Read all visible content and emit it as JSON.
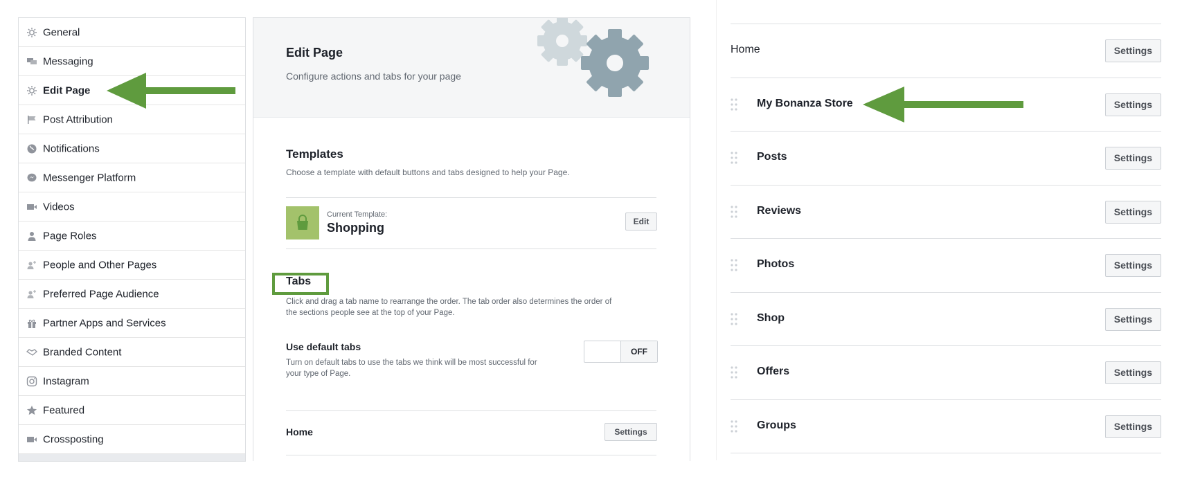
{
  "sidebar": {
    "items": [
      {
        "label": "General",
        "icon": "gear-icon",
        "active": false
      },
      {
        "label": "Messaging",
        "icon": "chat-bubbles-icon",
        "active": false
      },
      {
        "label": "Edit Page",
        "icon": "gear-icon",
        "active": true
      },
      {
        "label": "Post Attribution",
        "icon": "flag-icon",
        "active": false
      },
      {
        "label": "Notifications",
        "icon": "globe-icon",
        "active": false
      },
      {
        "label": "Messenger Platform",
        "icon": "messenger-icon",
        "active": false
      },
      {
        "label": "Videos",
        "icon": "video-camera-icon",
        "active": false
      },
      {
        "label": "Page Roles",
        "icon": "person-icon",
        "active": false
      },
      {
        "label": "People and Other Pages",
        "icon": "people-add-icon",
        "active": false
      },
      {
        "label": "Preferred Page Audience",
        "icon": "people-add-icon",
        "active": false
      },
      {
        "label": "Partner Apps and Services",
        "icon": "gift-box-icon",
        "active": false
      },
      {
        "label": "Branded Content",
        "icon": "handshake-icon",
        "active": false
      },
      {
        "label": "Instagram",
        "icon": "instagram-icon",
        "active": false
      },
      {
        "label": "Featured",
        "icon": "star-icon",
        "active": false
      },
      {
        "label": "Crossposting",
        "icon": "video-camera-icon",
        "active": false
      }
    ]
  },
  "main": {
    "title": "Edit Page",
    "subtitle": "Configure actions and tabs for your page",
    "templates": {
      "title": "Templates",
      "description": "Choose a template with default buttons and tabs designed to help your Page.",
      "current_label": "Current Template:",
      "current_name": "Shopping",
      "edit_label": "Edit"
    },
    "tabs": {
      "title": "Tabs",
      "description_line1": "Click and drag a tab name to rearrange the order. The tab order also determines the order of",
      "description_line2": "the sections people see at the top of your Page.",
      "default_title": "Use default tabs",
      "default_desc_line1": "Turn on default tabs to use the tabs we think will be most successful for",
      "default_desc_line2": "your type of Page.",
      "toggle_state": "OFF",
      "first_tab": "Home",
      "settings_label": "Settings"
    }
  },
  "right_panel": {
    "settings_label": "Settings",
    "tabs": [
      "Home",
      "My Bonanza Store",
      "Posts",
      "Reviews",
      "Photos",
      "Shop",
      "Offers",
      "Groups"
    ]
  },
  "colors": {
    "arrow": "#5f9b3e",
    "template_thumb": "#a3c26b",
    "gear_dark": "#90a4ae",
    "gear_light": "#cfd8dc"
  }
}
